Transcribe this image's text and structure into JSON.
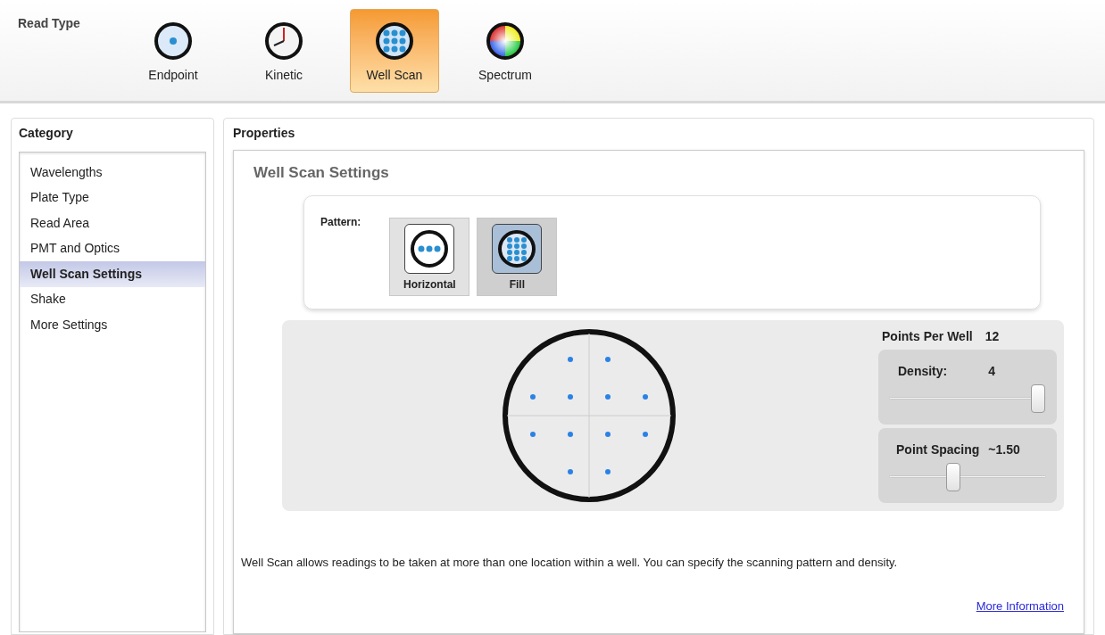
{
  "read_type": {
    "label": "Read Type",
    "options": [
      {
        "label": "Endpoint",
        "kind": "endpoint",
        "selected": false
      },
      {
        "label": "Kinetic",
        "kind": "kinetic",
        "selected": false
      },
      {
        "label": "Well Scan",
        "kind": "wellscan",
        "selected": true
      },
      {
        "label": "Spectrum",
        "kind": "spectrum",
        "selected": false
      }
    ]
  },
  "category": {
    "title": "Category",
    "items": [
      {
        "label": "Wavelengths",
        "selected": false
      },
      {
        "label": "Plate Type",
        "selected": false
      },
      {
        "label": "Read Area",
        "selected": false
      },
      {
        "label": "PMT and Optics",
        "selected": false
      },
      {
        "label": "Well Scan Settings",
        "selected": true
      },
      {
        "label": "Shake",
        "selected": false
      },
      {
        "label": "More Settings",
        "selected": false
      }
    ]
  },
  "properties": {
    "title": "Properties",
    "section_title": "Well Scan Settings",
    "pattern": {
      "label": "Pattern:",
      "options": [
        {
          "label": "Horizontal",
          "kind": "horizontal",
          "selected": false
        },
        {
          "label": "Fill",
          "kind": "fill",
          "selected": true
        }
      ]
    },
    "points_per_well": {
      "label": "Points Per Well",
      "value": "12"
    },
    "density": {
      "label": "Density:",
      "value": "4",
      "level": 1.0
    },
    "point_spacing": {
      "label": "Point Spacing",
      "value": "~1.50",
      "level": 0.4
    },
    "description": "Well Scan allows readings to be taken at more than one location within a well. You can specify the scanning pattern and density.",
    "link": "More Information"
  }
}
